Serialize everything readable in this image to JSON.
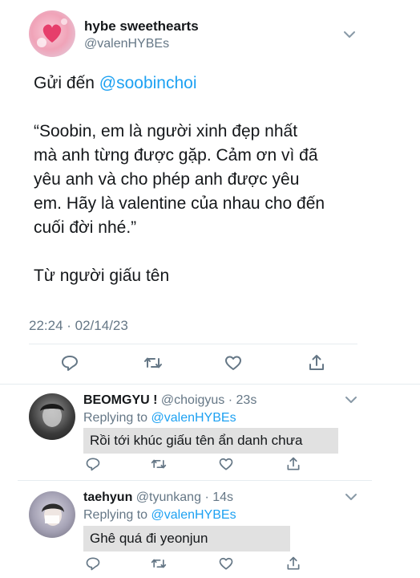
{
  "main_tweet": {
    "display_name": "hybe sweethearts",
    "handle": "@valenHYBEs",
    "to_prefix": "Gửi đến",
    "to_mention": "@soobinchoi",
    "quote_lines": [
      "“Soobin, em là người xinh đẹp nhất",
      "mà anh từng được gặp. Cảm ơn vì đã",
      "yêu anh và cho phép anh được yêu",
      "em. Hãy là valentine của nhau cho đến",
      "cuối đời nhé.”"
    ],
    "signature": "Từ người giấu tên",
    "timestamp": "22:24 · 02/14/23"
  },
  "replies": [
    {
      "display_name": "BEOMGYU !",
      "handle": "@choigyus",
      "time": "· 23s",
      "replying_prefix": "Replying to",
      "replying_to": "@valenHYBEs",
      "text": "Rồi tới khúc giấu tên ẩn danh chưa"
    },
    {
      "display_name": "taehyun",
      "handle": "@tyunkang",
      "time": "· 14s",
      "replying_prefix": "Replying to",
      "replying_to": "@valenHYBEs",
      "text": "Ghê quá đi yeonjun"
    }
  ],
  "icons": [
    "reply-icon",
    "retweet-icon",
    "like-icon",
    "share-icon",
    "chevron-down-icon"
  ],
  "colors": {
    "link": "#1da1f2",
    "muted": "#657786",
    "divider": "#e6ecf0",
    "reply_box": "#e1e1e1"
  }
}
